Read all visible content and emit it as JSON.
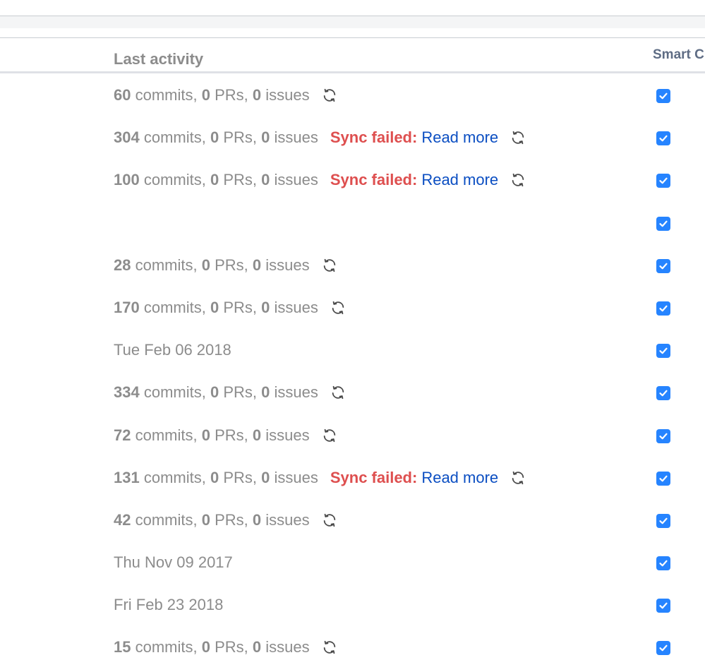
{
  "table": {
    "columns": {
      "last_activity": "Last activity",
      "smart": "Smart C"
    },
    "rows": [
      {
        "type": "counts",
        "commits": "60",
        "prs": "0",
        "issues": "0",
        "sync_failed": false,
        "checked": true
      },
      {
        "type": "counts",
        "commits": "304",
        "prs": "0",
        "issues": "0",
        "sync_failed": true,
        "checked": true
      },
      {
        "type": "counts",
        "commits": "100",
        "prs": "0",
        "issues": "0",
        "sync_failed": true,
        "checked": true
      },
      {
        "type": "empty",
        "checked": true
      },
      {
        "type": "counts",
        "commits": "28",
        "prs": "0",
        "issues": "0",
        "sync_failed": false,
        "checked": true
      },
      {
        "type": "counts",
        "commits": "170",
        "prs": "0",
        "issues": "0",
        "sync_failed": false,
        "checked": true
      },
      {
        "type": "date",
        "date": "Tue Feb 06 2018",
        "checked": true
      },
      {
        "type": "counts",
        "commits": "334",
        "prs": "0",
        "issues": "0",
        "sync_failed": false,
        "checked": true
      },
      {
        "type": "counts",
        "commits": "72",
        "prs": "0",
        "issues": "0",
        "sync_failed": false,
        "checked": true
      },
      {
        "type": "counts",
        "commits": "131",
        "prs": "0",
        "issues": "0",
        "sync_failed": true,
        "checked": true
      },
      {
        "type": "counts",
        "commits": "42",
        "prs": "0",
        "issues": "0",
        "sync_failed": false,
        "checked": true
      },
      {
        "type": "date",
        "date": "Thu Nov 09 2017",
        "checked": true
      },
      {
        "type": "date",
        "date": "Fri Feb 23 2018",
        "checked": true
      },
      {
        "type": "counts",
        "commits": "15",
        "prs": "0",
        "issues": "0",
        "sync_failed": false,
        "checked": true
      }
    ]
  },
  "labels": {
    "commits": " commits, ",
    "prs": " PRs, ",
    "issues": " issues",
    "sync_failed": "Sync failed:",
    "read_more": "Read more"
  },
  "icons": {
    "refresh": "refresh-icon",
    "check": "check-icon"
  },
  "colors": {
    "muted_text": "#8c8c8c",
    "header_text": "#5e6c84",
    "error": "#de4f4f",
    "link": "#0b4ec2",
    "checkbox": "#2684ff"
  }
}
